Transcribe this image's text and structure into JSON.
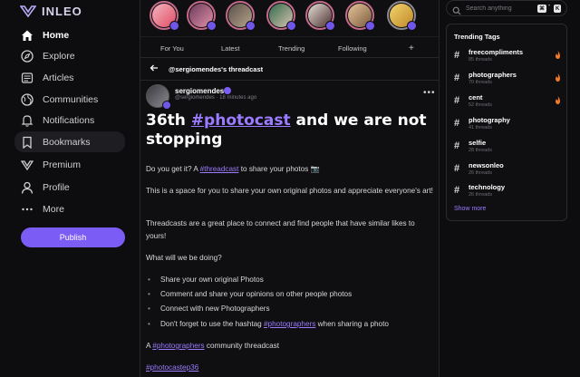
{
  "brand": {
    "logo_text": "INLEO",
    "accent": "#7b5cf5"
  },
  "nav": [
    {
      "label": "Home",
      "icon": "home-icon"
    },
    {
      "label": "Explore",
      "icon": "compass-icon"
    },
    {
      "label": "Articles",
      "icon": "article-icon"
    },
    {
      "label": "Communities",
      "icon": "globe-icon"
    },
    {
      "label": "Notifications",
      "icon": "bell-icon"
    },
    {
      "label": "Bookmarks",
      "icon": "bookmark-icon"
    },
    {
      "label": "Premium",
      "icon": "premium-icon"
    },
    {
      "label": "Profile",
      "icon": "user-icon"
    },
    {
      "label": "More",
      "icon": "more-icon"
    }
  ],
  "publish_label": "Publish",
  "feed_tabs": [
    "For You",
    "Latest",
    "Trending",
    "Following",
    "+"
  ],
  "thread_header": "@sergiomendes's threadcast",
  "post": {
    "author": "sergiomendes",
    "handle": "@sergiomendes",
    "time": "18 minutes ago",
    "title_before": "36th ",
    "title_link": "#photocast",
    "title_after": " and we are not stopping",
    "p1_before": "Do you get it? A ",
    "p1_link": "#threadcast",
    "p1_after": " to share your photos 📷",
    "p2": "This is a space for you to share your own original photos and appreciate everyone's art!",
    "p3": "Threadcasts are a great place to connect and find people that have similar likes to yours!",
    "p4": "What will we be doing?",
    "bullets": [
      "Share your own original Photos",
      "Comment and share your opinions on other people photos",
      "Connect with new Photographers"
    ],
    "bullet4_before": "Don't forget to use the hashtag ",
    "bullet4_link": "#photographers",
    "bullet4_after": " when sharing a photo",
    "p5_before": "A ",
    "p5_link": "#photographers",
    "p5_after": " community threadcast",
    "footer_tag": "#photocastep36"
  },
  "search": {
    "placeholder": "Search anything",
    "shortcut_1": "⌘",
    "shortcut_2": "K"
  },
  "trending": {
    "title": "Trending Tags",
    "tags": [
      {
        "name": "freecompliments",
        "count": "85 threads",
        "hot": true
      },
      {
        "name": "photographers",
        "count": "70 threads",
        "hot": true
      },
      {
        "name": "cent",
        "count": "52 threads",
        "hot": true
      },
      {
        "name": "photography",
        "count": "41 threads",
        "hot": false
      },
      {
        "name": "selfie",
        "count": "28 threads",
        "hot": false
      },
      {
        "name": "newsonleo",
        "count": "26 threads",
        "hot": false
      },
      {
        "name": "technology",
        "count": "26 threads",
        "hot": false
      }
    ],
    "show_more": "Show more"
  }
}
